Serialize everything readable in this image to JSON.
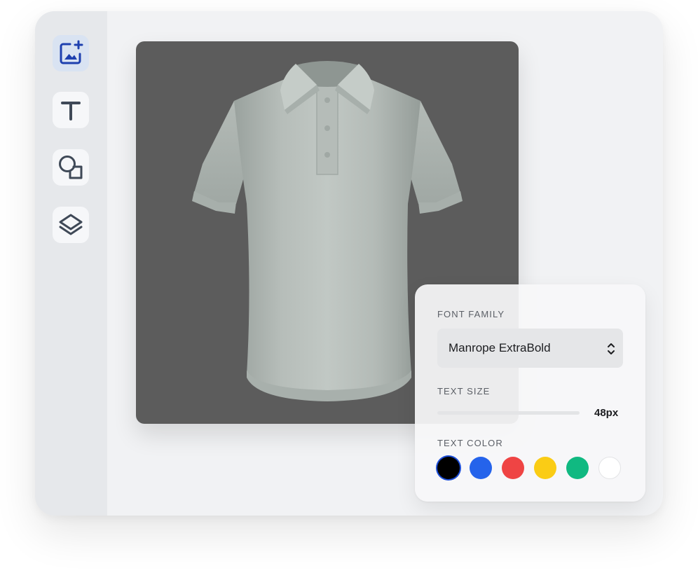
{
  "toolbar": {
    "tools": [
      {
        "name": "add-image",
        "icon": "image-plus-icon",
        "active": true
      },
      {
        "name": "text",
        "icon": "text-t-icon",
        "active": false
      },
      {
        "name": "shapes",
        "icon": "shapes-icon",
        "active": false
      },
      {
        "name": "layers",
        "icon": "layers-icon",
        "active": false
      }
    ]
  },
  "canvas": {
    "background": "#5c5c5c",
    "product": "polo-shirt",
    "shirt_color": "#b9c0bc"
  },
  "panel": {
    "font_family": {
      "label": "FONT FAMILY",
      "value": "Manrope ExtraBold",
      "icon": "chevron-up-down-icon"
    },
    "text_size": {
      "label": "TEXT SIZE",
      "value": "48px",
      "level": 0.0
    },
    "text_color": {
      "label": "TEXT COLOR",
      "swatches": [
        "#000000",
        "#2563eb",
        "#ef4444",
        "#facc15",
        "#10b981",
        "#ffffff"
      ],
      "selected_index": 0
    }
  },
  "colors": {
    "accent": "#1d4ed8",
    "icon": "#3f4957"
  }
}
